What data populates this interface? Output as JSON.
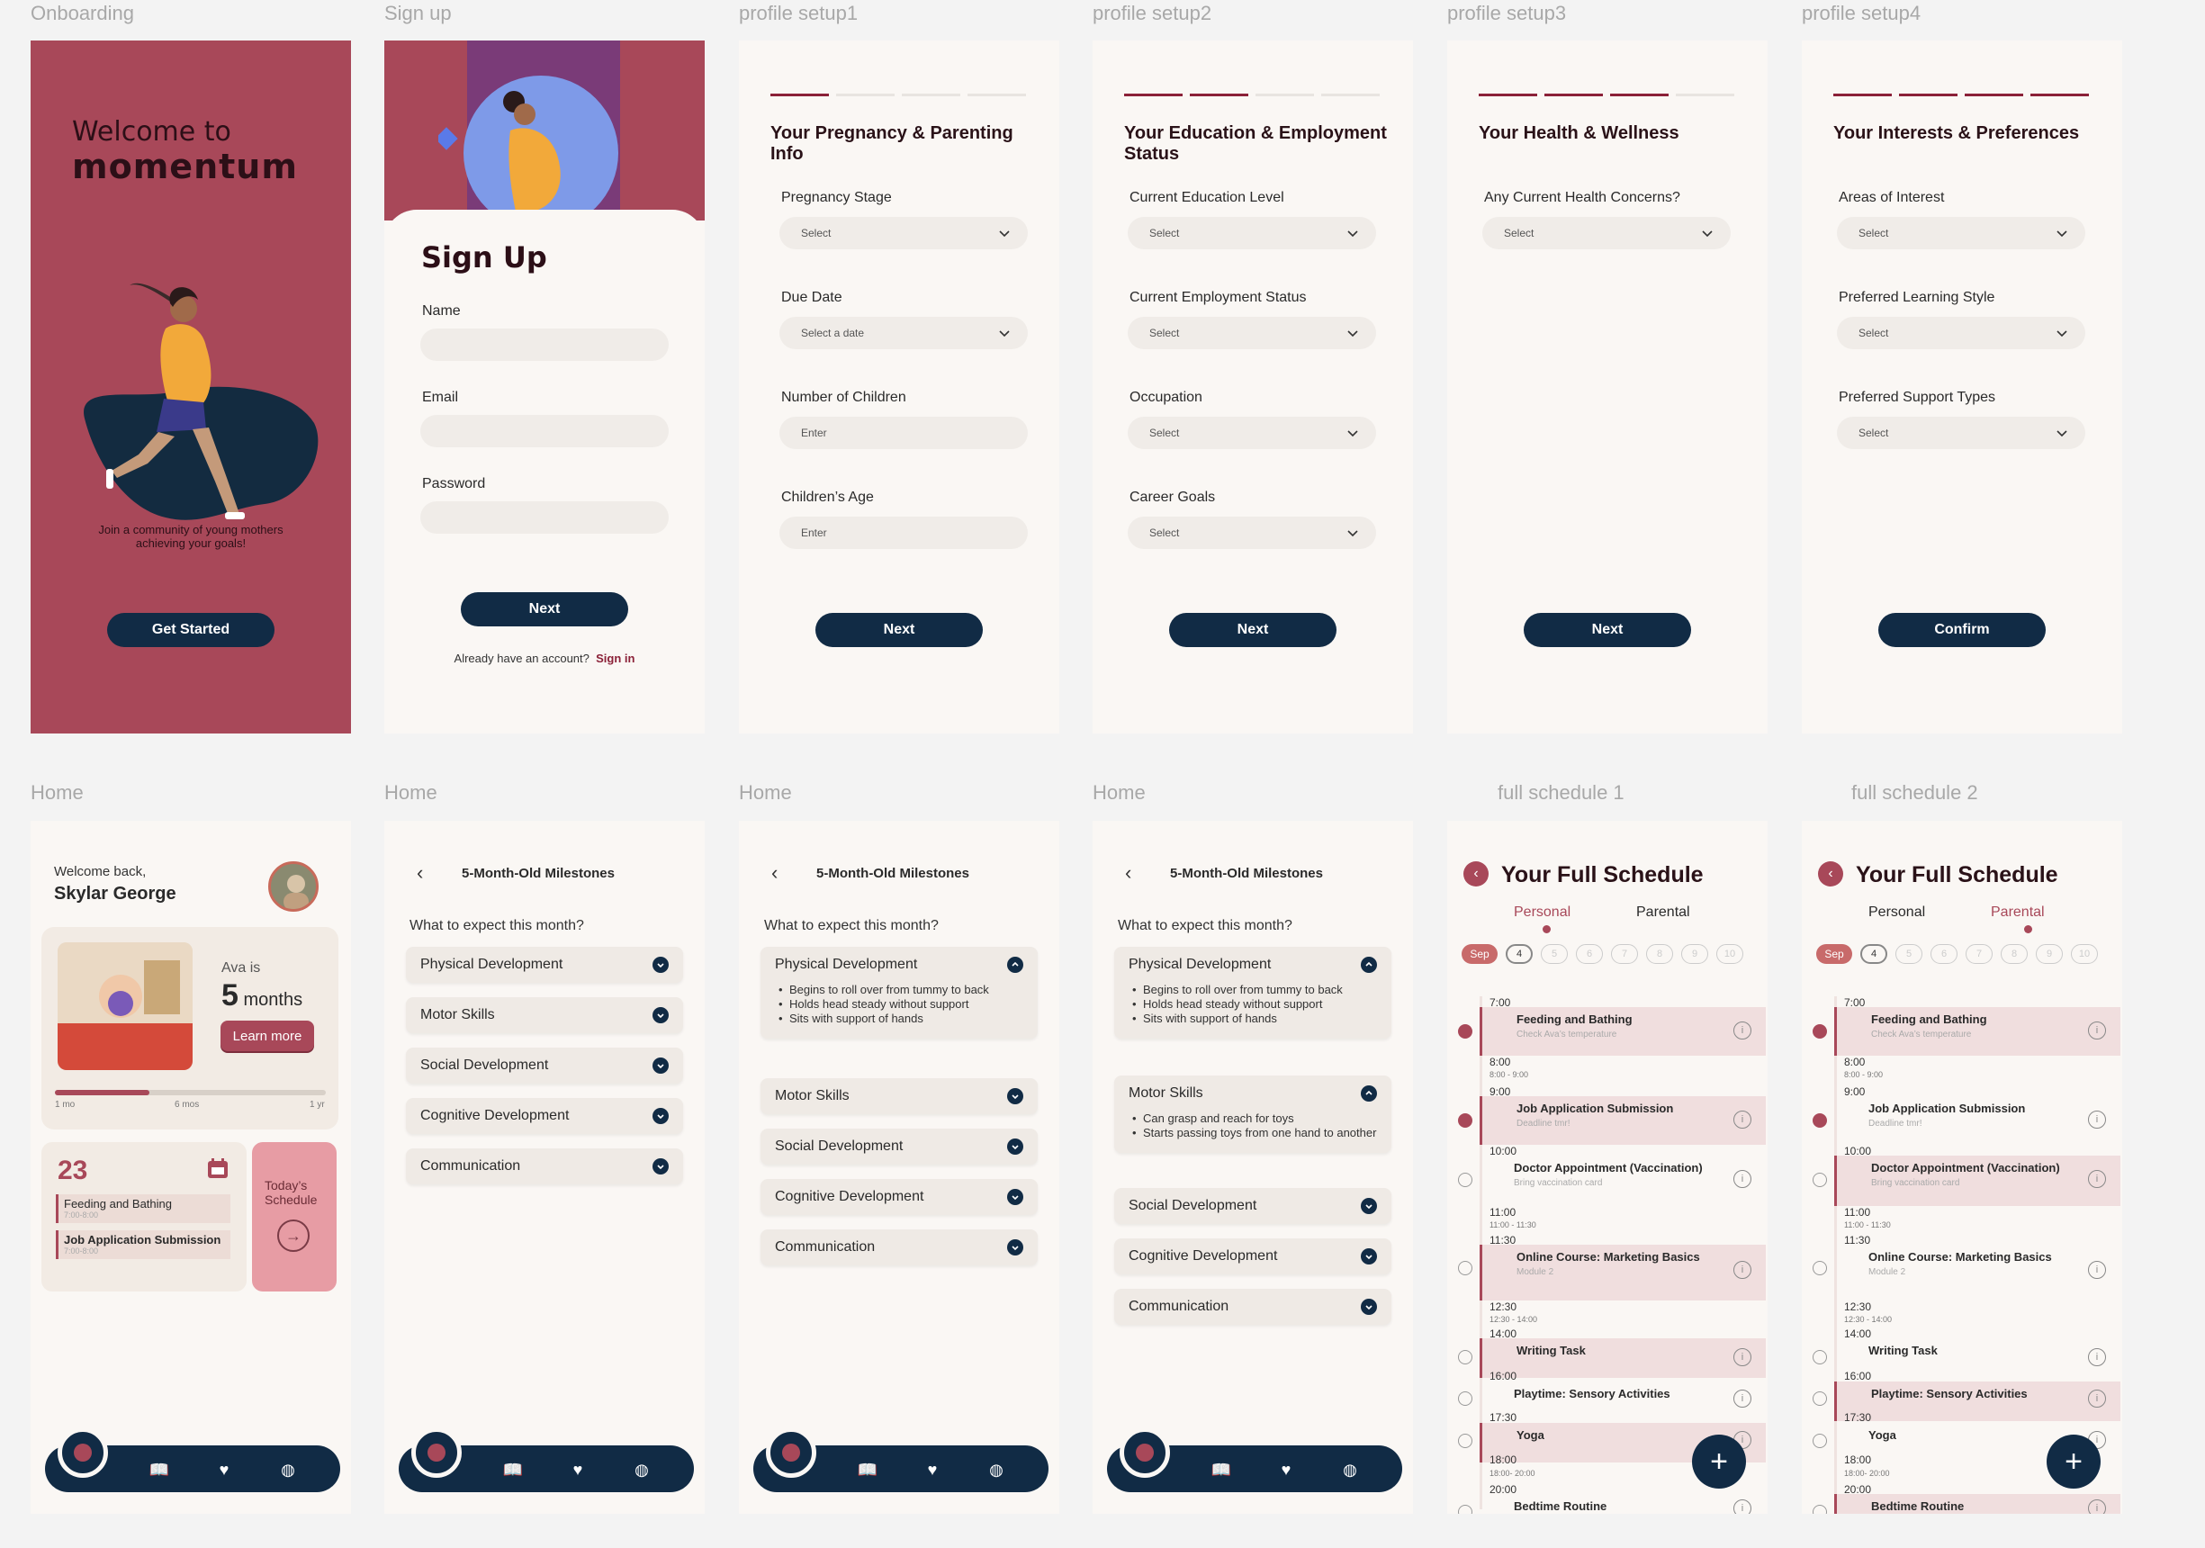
{
  "frame_labels": [
    "Onboarding",
    "Sign up",
    "profile setup1",
    "profile setup2",
    "profile setup3",
    "profile setup4",
    "Home",
    "Home",
    "Home",
    "Home",
    "full schedule 1",
    "full schedule 2"
  ],
  "onboarding": {
    "welcome": "Welcome to",
    "brand": "momentum",
    "tagline": "Join a community of young mothers achieving your goals!",
    "cta": "Get Started"
  },
  "signup": {
    "title": "Sign Up",
    "name_label": "Name",
    "email_label": "Email",
    "password_label": "Password",
    "cta": "Next",
    "account_text": "Already have an account?",
    "signin": "Sign in"
  },
  "setup1": {
    "title": "Your Pregnancy & Parenting Info",
    "fields": [
      {
        "label": "Pregnancy Stage",
        "value": "Select"
      },
      {
        "label": "Due Date",
        "value": "Select a date"
      },
      {
        "label": "Number of Children",
        "value": "Enter"
      },
      {
        "label": "Children’s Age",
        "value": "Enter"
      }
    ],
    "cta": "Next",
    "progress": 1
  },
  "setup2": {
    "title": "Your Education & Employment Status",
    "fields": [
      {
        "label": "Current Education Level",
        "value": "Select"
      },
      {
        "label": "Current Employment Status",
        "value": "Select"
      },
      {
        "label": "Occupation",
        "value": "Select"
      },
      {
        "label": "Career Goals",
        "value": "Select"
      }
    ],
    "cta": "Next",
    "progress": 2
  },
  "setup3": {
    "title": "Your Health & Wellness",
    "fields": [
      {
        "label": "Any Current Health Concerns?",
        "value": "Select"
      }
    ],
    "cta": "Next",
    "progress": 3
  },
  "setup4": {
    "title": "Your Interests & Preferences",
    "fields": [
      {
        "label": "Areas of Interest",
        "value": "Select"
      },
      {
        "label": "Preferred Learning Style",
        "value": "Select"
      },
      {
        "label": "Preferred Support Types",
        "value": "Select"
      }
    ],
    "cta": "Confirm",
    "progress": 4
  },
  "home": {
    "welcome": "Welcome back,",
    "name": "Skylar George",
    "ava_is": "Ava is",
    "months_num": "5",
    "months_word": "months",
    "learn_more": "Learn more",
    "ticks": [
      "1 mo",
      "6 mos",
      "1 yr"
    ],
    "progress": 0.35,
    "date": "23",
    "events": [
      {
        "name": "Feeding and Bathing",
        "time": "7:00-8:00"
      },
      {
        "name": "Job Application Submission",
        "time": "7:00-8:00"
      }
    ],
    "today_schedule": "Today’s Schedule"
  },
  "milestones": {
    "title": "5-Month-Old Milestones",
    "question": "What to expect this month?",
    "sections": [
      "Physical Development",
      "Motor Skills",
      "Social Development",
      "Cognitive Development",
      "Communication"
    ],
    "physical_items": [
      "Begins to roll over from tummy to back",
      "Holds head steady without support",
      "Sits with support of hands"
    ],
    "motor_items": [
      "Can grasp and reach for toys",
      "Starts passing toys from one hand to another"
    ]
  },
  "schedule": {
    "title": "Your Full Schedule",
    "tabs": [
      "Personal",
      "Parental"
    ],
    "month": "Sep",
    "days": [
      "4",
      "5",
      "6",
      "7",
      "8",
      "9",
      "10"
    ],
    "entries": [
      {
        "time": "7:00",
        "name": "Feeding and Bathing",
        "sub": "Check Ava’s temperature",
        "range": "8:00",
        "range2": "8:00 - 9:00"
      },
      {
        "time": "9:00",
        "name": "Job Application Submission",
        "sub": "Deadline tmr!",
        "range": "10:00"
      },
      {
        "time": "",
        "name": "Doctor Appointment (Vaccination)",
        "sub": "Bring vaccination card",
        "range": "11:00",
        "range2": "11:00 - 11:30"
      },
      {
        "time": "11:30",
        "name": "Online Course: Marketing Basics",
        "sub": "Module 2",
        "range": "12:30",
        "range2": "12:30 - 14:00"
      },
      {
        "time": "14:00",
        "name": "Writing Task",
        "sub": "",
        "range": "16:00"
      },
      {
        "time": "",
        "name": "Playtime: Sensory Activities",
        "sub": "",
        "range": "17:30"
      },
      {
        "time": "",
        "name": "Yoga",
        "sub": "",
        "range": "18:00",
        "range2": "18:00- 20:00"
      },
      {
        "time": "20:00",
        "name": "Bedtime Routine",
        "sub": ""
      }
    ]
  }
}
